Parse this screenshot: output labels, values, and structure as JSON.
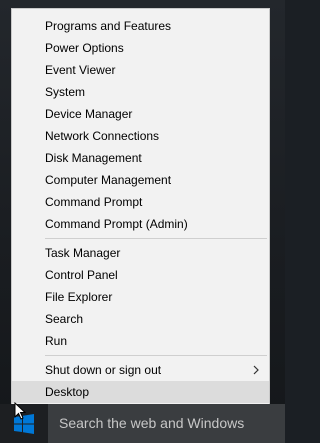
{
  "menu": {
    "items": [
      {
        "label": "Programs and Features"
      },
      {
        "label": "Power Options"
      },
      {
        "label": "Event Viewer"
      },
      {
        "label": "System"
      },
      {
        "label": "Device Manager"
      },
      {
        "label": "Network Connections"
      },
      {
        "label": "Disk Management"
      },
      {
        "label": "Computer Management"
      },
      {
        "label": "Command Prompt"
      },
      {
        "label": "Command Prompt (Admin)"
      },
      {
        "label": "Task Manager"
      },
      {
        "label": "Control Panel"
      },
      {
        "label": "File Explorer"
      },
      {
        "label": "Search"
      },
      {
        "label": "Run"
      },
      {
        "label": "Shut down or sign out"
      },
      {
        "label": "Desktop"
      }
    ],
    "selected_label": "Desktop",
    "submenu_icon": "chevron-right-icon"
  },
  "taskbar": {
    "search_placeholder": "Search the web and Windows",
    "start_icon": "windows-logo-icon",
    "accent_color": "#0078d7"
  }
}
